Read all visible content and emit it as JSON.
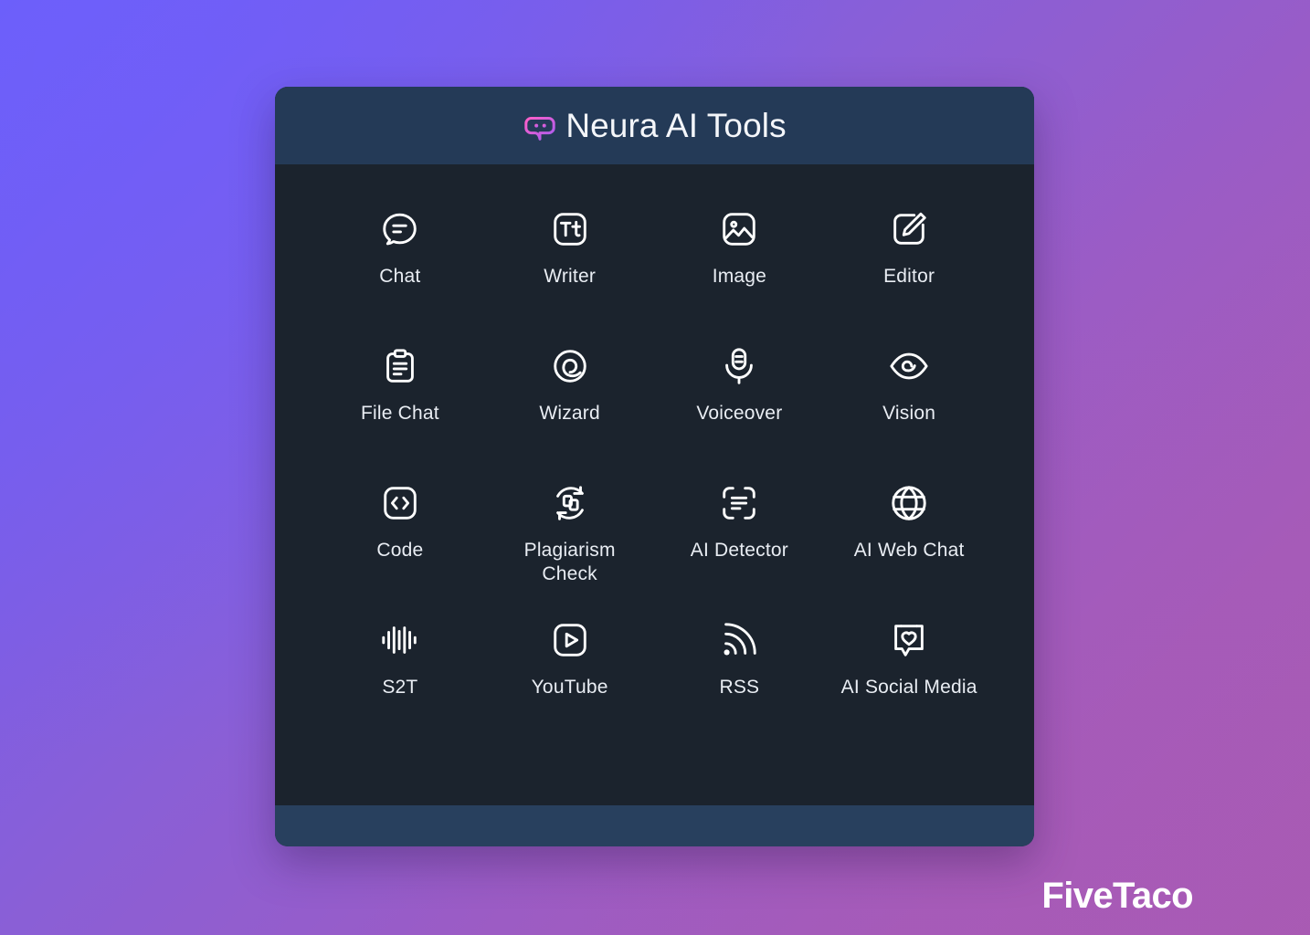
{
  "background": {
    "gradient_from": "#6b5ff8",
    "gradient_to": "#a95bb0"
  },
  "card": {
    "header": {
      "title": "Neura AI Tools",
      "logo_icon": "chat-bubble-logo-icon",
      "logo_gradient_from": "#ff5fc8",
      "logo_gradient_to": "#a45cf0",
      "background_color": "#243a57"
    },
    "body": {
      "background_color": "#1b232d",
      "tools": [
        {
          "label": "Chat",
          "icon": "chat-bubble-icon"
        },
        {
          "label": "Writer",
          "icon": "text-tt-icon"
        },
        {
          "label": "Image",
          "icon": "image-picture-icon"
        },
        {
          "label": "Editor",
          "icon": "pencil-edit-icon"
        },
        {
          "label": "File Chat",
          "icon": "clipboard-document-icon"
        },
        {
          "label": "Wizard",
          "icon": "spiral-icon"
        },
        {
          "label": "Voiceover",
          "icon": "microphone-icon"
        },
        {
          "label": "Vision",
          "icon": "eye-icon"
        },
        {
          "label": "Code",
          "icon": "code-brackets-icon"
        },
        {
          "label": "Plagiarism Check",
          "icon": "documents-refresh-icon"
        },
        {
          "label": "AI Detector",
          "icon": "scan-text-icon"
        },
        {
          "label": "AI Web Chat",
          "icon": "globe-www-icon"
        },
        {
          "label": "S2T",
          "icon": "audio-waveform-icon"
        },
        {
          "label": "YouTube",
          "icon": "play-button-icon"
        },
        {
          "label": "RSS",
          "icon": "rss-signal-icon"
        },
        {
          "label": "AI Social Media",
          "icon": "speech-bubble-heart-icon"
        }
      ],
      "label_color": "#e9edf3",
      "icon_color": "#ffffff"
    },
    "footer": {
      "background_color": "#28405e"
    }
  },
  "watermark": {
    "text": "FiveTaco",
    "color": "#ffffff"
  }
}
